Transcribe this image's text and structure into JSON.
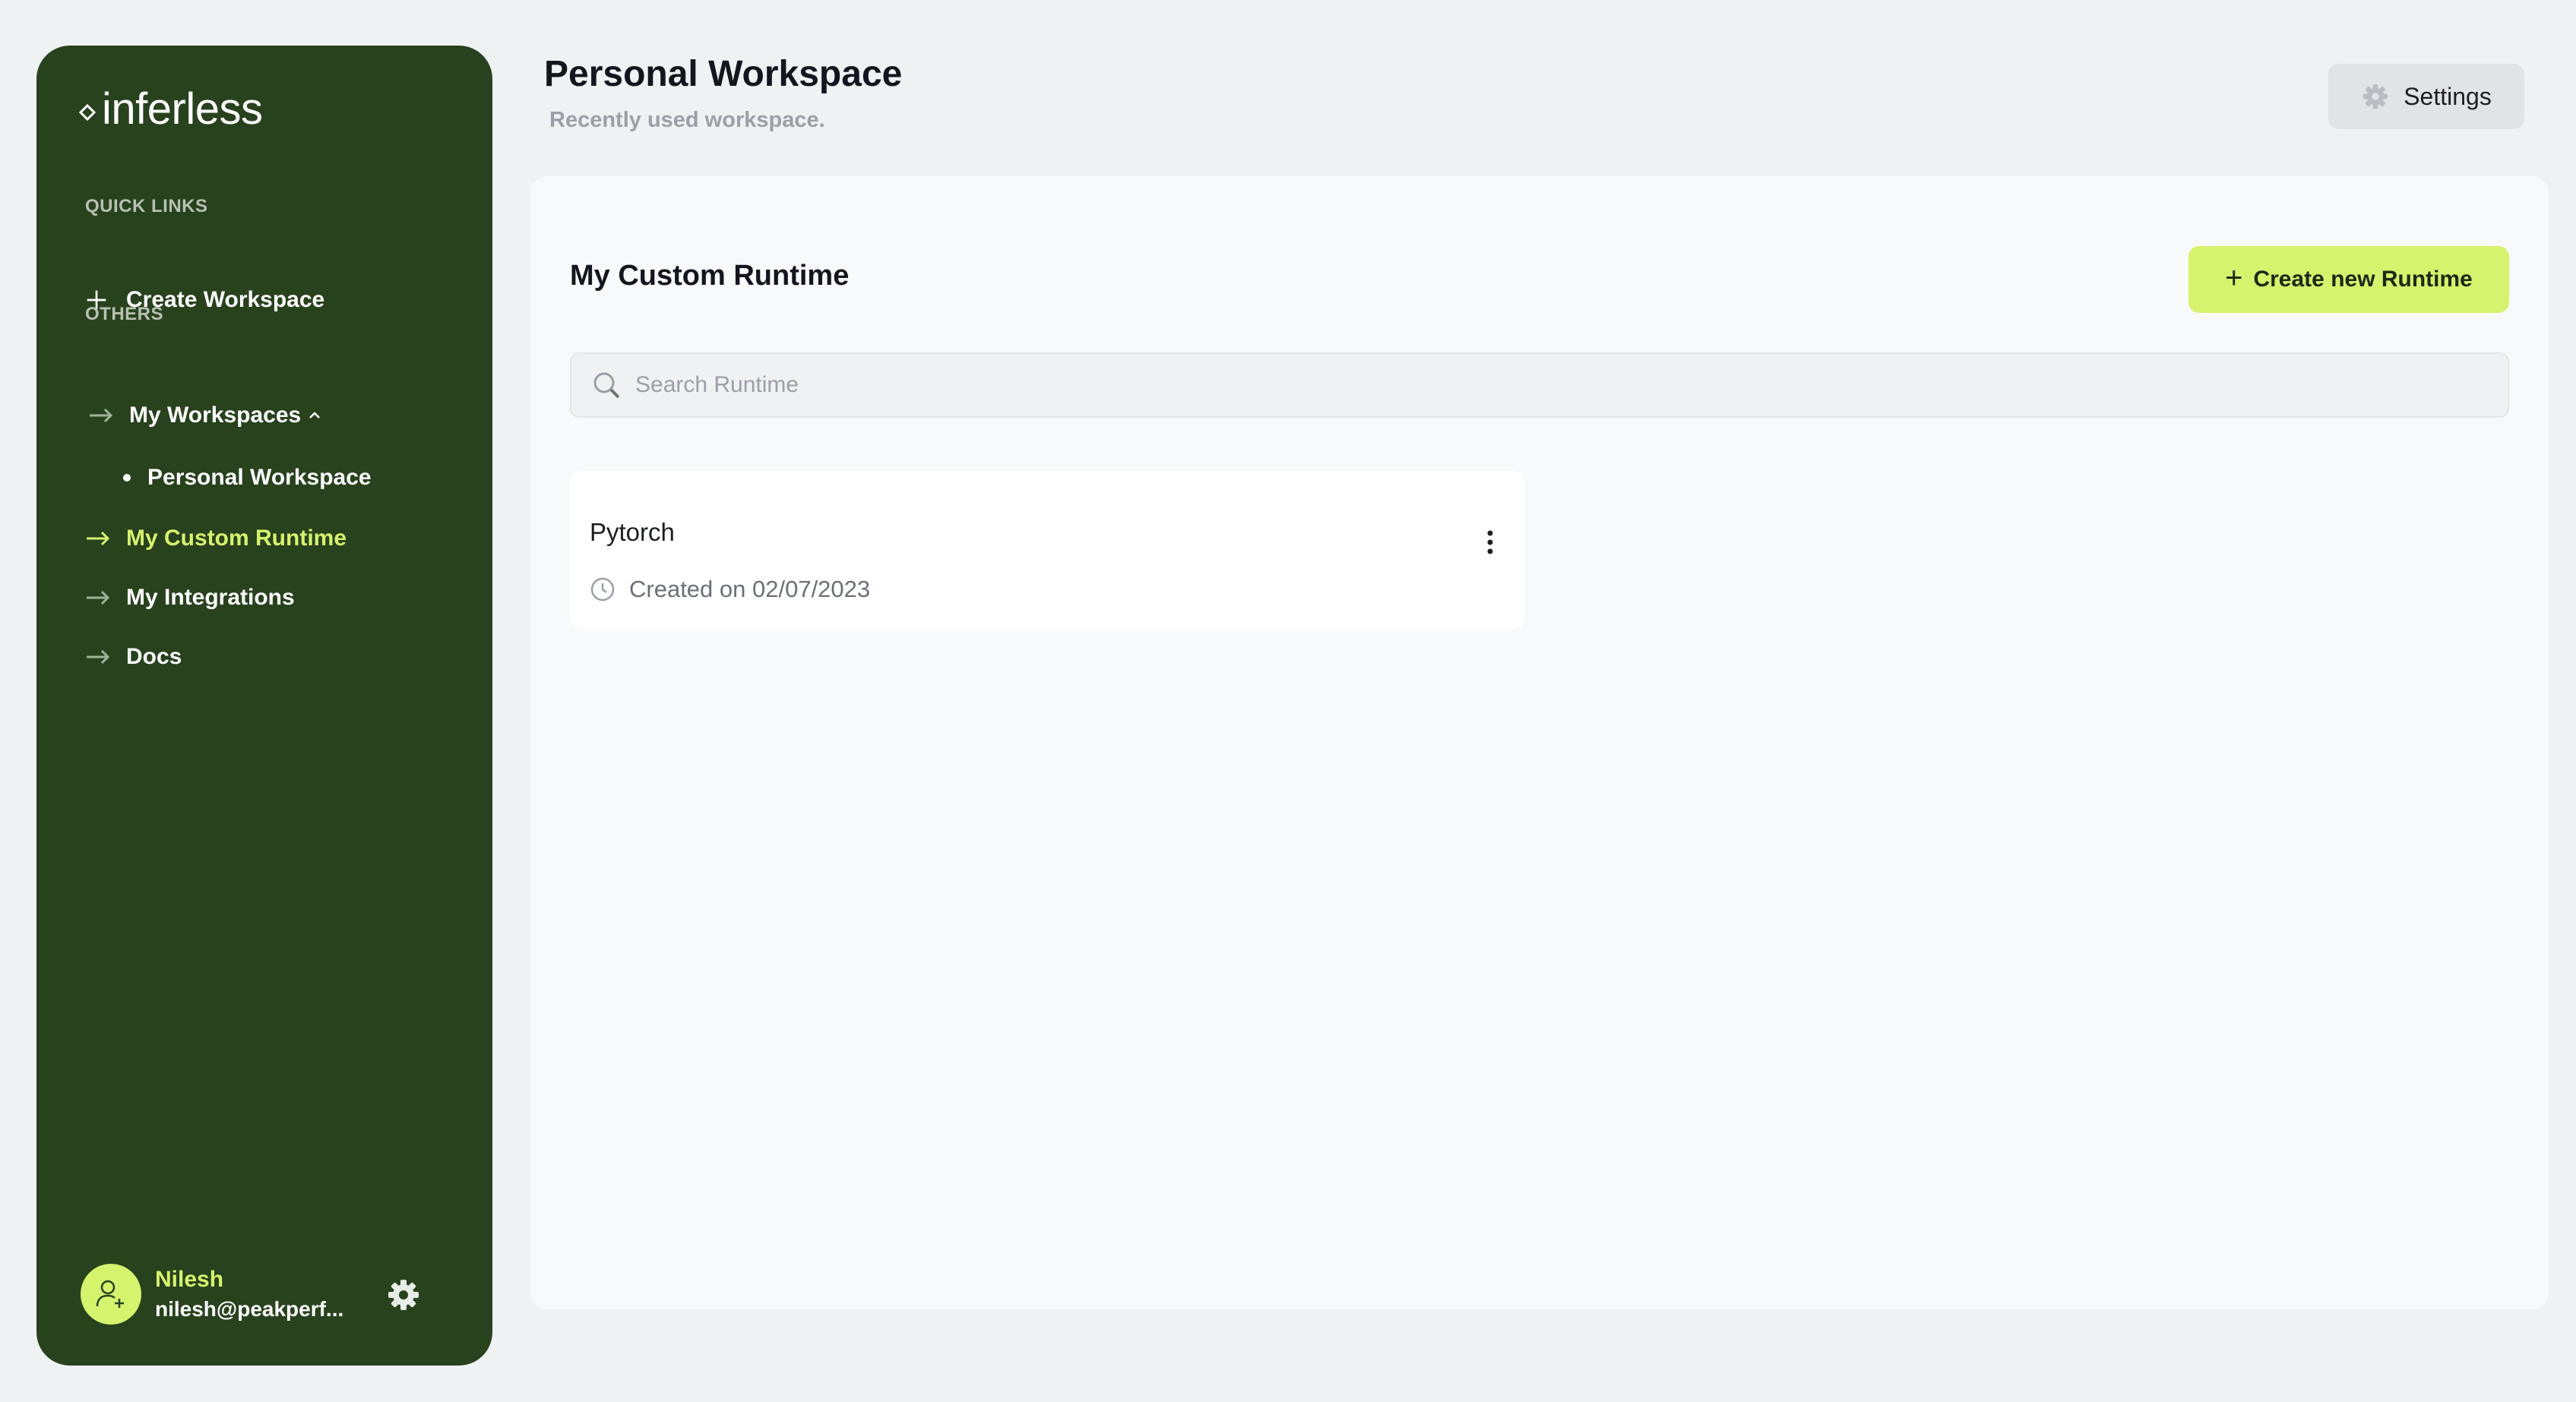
{
  "sidebar": {
    "logo_text": "inferless",
    "quick_links_label": "QUICK LINKS",
    "create_workspace_label": "Create Workspace",
    "others_label": "OTHERS",
    "my_workspaces_label": "My Workspaces",
    "personal_workspace_label": "Personal Workspace",
    "my_custom_runtime_label": "My Custom Runtime",
    "my_integrations_label": "My Integrations",
    "docs_label": "Docs",
    "user_name": "Nilesh",
    "user_email": "nilesh@peakperf..."
  },
  "header": {
    "title": "Personal Workspace",
    "subtitle": "Recently used workspace.",
    "settings_label": "Settings"
  },
  "main": {
    "section_title": "My Custom Runtime",
    "create_button_label": "Create new Runtime",
    "search_placeholder": "Search Runtime",
    "runtimes": [
      {
        "name": "Pytorch",
        "created": "Created on 02/07/2023"
      }
    ]
  },
  "colors": {
    "sidebar_bg": "#28421e",
    "accent": "#d6f36e",
    "page_bg": "#eff2f3"
  },
  "icons": [
    "logo-mark-icon",
    "plus-icon",
    "arrow-right-icon",
    "chevron-up-icon",
    "user-add-icon",
    "gear-icon",
    "search-icon",
    "clock-icon",
    "more-vertical-icon"
  ]
}
